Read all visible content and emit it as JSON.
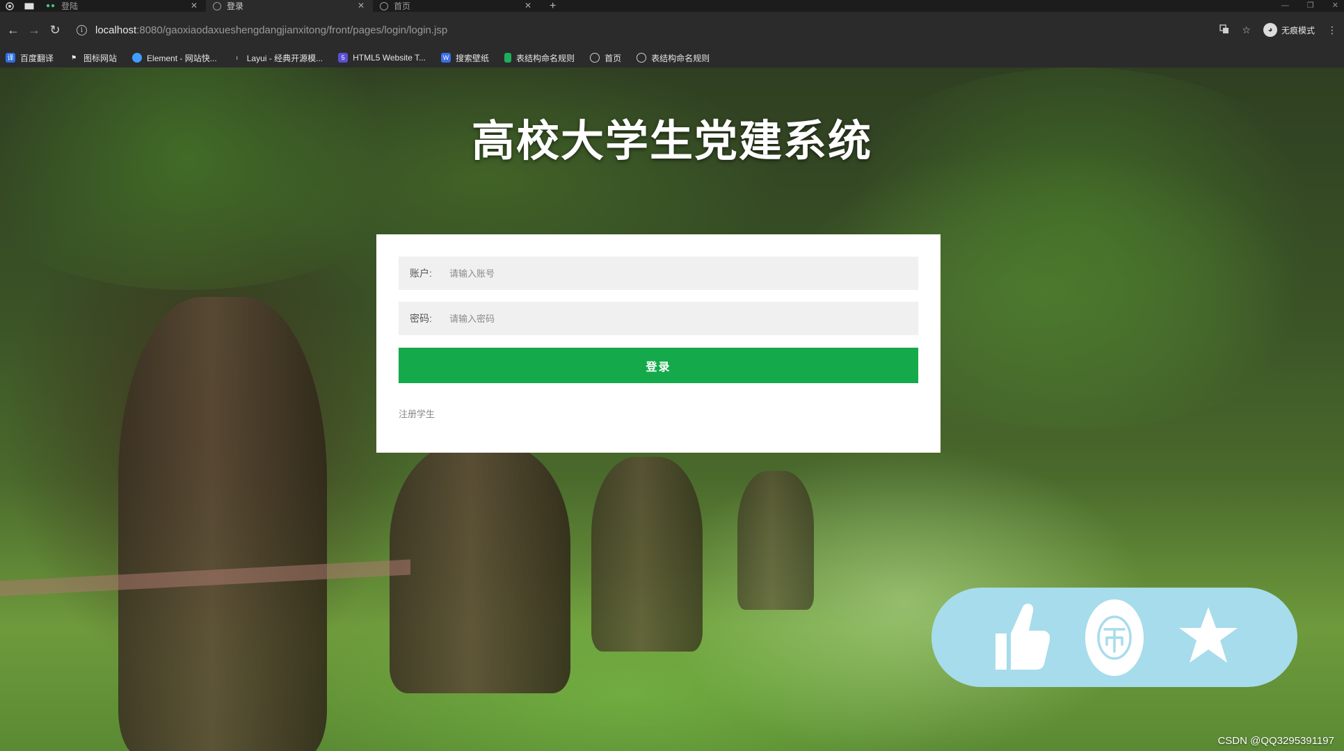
{
  "browser": {
    "tabs": [
      {
        "title": "登陆",
        "active": false
      },
      {
        "title": "登录",
        "active": true
      },
      {
        "title": "首页",
        "active": false
      }
    ],
    "url_host": "localhost",
    "url_path": ":8080/gaoxiaodaxueshengdangjianxitong/front/pages/login/login.jsp",
    "profile_label": "无痕模式",
    "bookmarks": [
      {
        "label": "百度翻译",
        "icon": "translate-icon",
        "color": "#2f6fe0"
      },
      {
        "label": "图标网站",
        "icon": "flag-icon",
        "color": "#444444"
      },
      {
        "label": "Element - 网站快...",
        "icon": "element-icon",
        "color": "#409eff"
      },
      {
        "label": "Layui - 经典开源模...",
        "icon": "layui-icon",
        "color": "#555555"
      },
      {
        "label": "HTML5 Website T...",
        "icon": "html5-icon",
        "color": "#5a4fd6"
      },
      {
        "label": "搜索壁纸",
        "icon": "wallpaper-icon",
        "color": "#3a6ee8"
      },
      {
        "label": "表结构命名规则",
        "icon": "doc-icon",
        "color": "#1fae5b"
      },
      {
        "label": "首页",
        "icon": "globe-icon",
        "color": "#777777"
      },
      {
        "label": "表结构命名规则",
        "icon": "globe-icon",
        "color": "#777777"
      }
    ]
  },
  "page": {
    "title": "高校大学生党建系统",
    "account_label": "账户:",
    "account_placeholder": "请输入账号",
    "password_label": "密码:",
    "password_placeholder": "请输入密码",
    "login_button": "登录",
    "register_link": "注册学生",
    "accent_color": "#14aa4b",
    "watermark": "CSDN @QQ3295391197"
  },
  "floating_actions": [
    {
      "name": "like",
      "icon": "thumbs-up-icon"
    },
    {
      "name": "coin",
      "icon": "coin-icon"
    },
    {
      "name": "favorite",
      "icon": "star-icon"
    }
  ]
}
